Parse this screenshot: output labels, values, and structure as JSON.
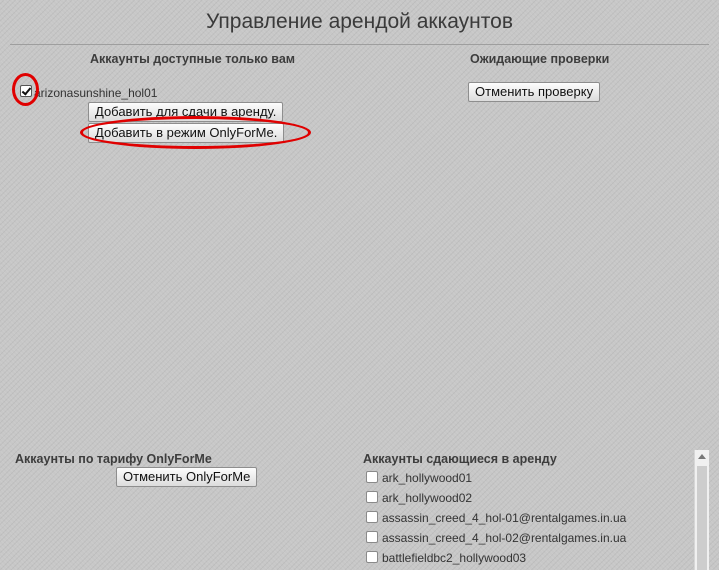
{
  "page": {
    "title": "Управление арендой аккаунтов"
  },
  "exclusive": {
    "heading": "Аккаунты доступные только вам",
    "account": {
      "label": "arizonasunshine_hol01",
      "checked": true
    },
    "add_for_rent_label": "Добавить для сдачи в аренду.",
    "add_onlyforme_label": "Добавить в режим OnlyForMe."
  },
  "pending": {
    "heading": "Ожидающие проверки",
    "cancel_check_label": "Отменить проверку"
  },
  "onlyforme": {
    "heading": "Аккаунты по тарифу OnlyForMe",
    "cancel_label": "Отменить OnlyForMe"
  },
  "rented": {
    "heading": "Аккаунты сдающиеся в аренду",
    "items": [
      {
        "label": "ark_hollywood01"
      },
      {
        "label": "ark_hollywood02"
      },
      {
        "label": "assassin_creed_4_hol-01@rentalgames.in.ua"
      },
      {
        "label": "assassin_creed_4_hol-02@rentalgames.in.ua"
      },
      {
        "label": "battlefieldbc2_hollywood03"
      }
    ]
  },
  "annotation_color": "#e00000"
}
